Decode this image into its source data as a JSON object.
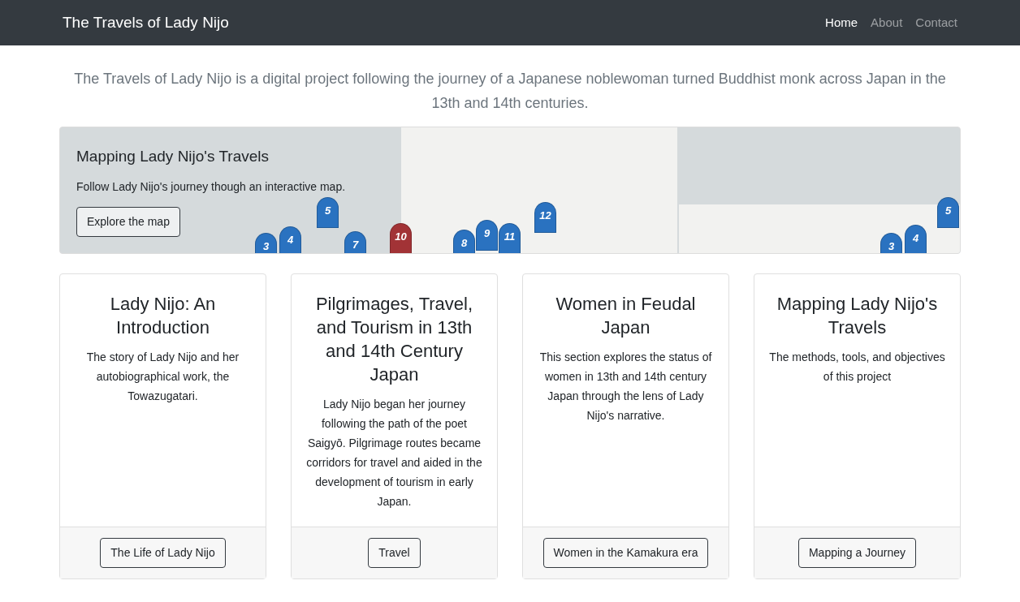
{
  "navbar": {
    "brand": "The Travels of Lady Nijo",
    "links": [
      {
        "label": "Home",
        "selected": true
      },
      {
        "label": "About",
        "selected": false
      },
      {
        "label": "Contact",
        "selected": false
      }
    ]
  },
  "intro": "The Travels of Lady Nijo is a digital project following the journey of a Japanese noblewoman turned Buddhist monk across Japan in the 13th and 14th centuries.",
  "map_banner": {
    "title": "Mapping Lady Nijo's Travels",
    "text": "Follow Lady Nijo's journey though an interactive map.",
    "button": "Explore the map",
    "markers": [
      {
        "label": "3",
        "color": "#2a72c0"
      },
      {
        "label": "4",
        "color": "#2a72c0"
      },
      {
        "label": "5",
        "color": "#2a72c0"
      },
      {
        "label": "7",
        "color": "#2a72c0"
      },
      {
        "label": "10",
        "color": "#a23336"
      },
      {
        "label": "8",
        "color": "#2a72c0"
      },
      {
        "label": "9",
        "color": "#2a72c0"
      },
      {
        "label": "11",
        "color": "#2a72c0"
      },
      {
        "label": "12",
        "color": "#2a72c0"
      },
      {
        "label": "5",
        "color": "#2a72c0"
      },
      {
        "label": "3",
        "color": "#2a72c0"
      },
      {
        "label": "4",
        "color": "#2a72c0"
      }
    ]
  },
  "cards": [
    {
      "title": "Lady Nijo: An Introduction",
      "text": "The story of Lady Nijo and her autobiographical work, the Towazugatari.",
      "button": "The Life of Lady Nijo"
    },
    {
      "title": "Pilgrimages, Travel, and Tourism in 13th and 14th Century Japan",
      "text": "Lady Nijo began her journey following the path of the poet Saigyō. Pilgrimage routes became corridors for travel and aided in the development of tourism in early Japan.",
      "button": "Travel"
    },
    {
      "title": "Women in Feudal Japan",
      "text": "This section explores the status of women in 13th and 14th century Japan through the lens of Lady Nijo's narrative.",
      "button": "Women in the Kamakura era"
    },
    {
      "title": "Mapping Lady Nijo's Travels",
      "text": "The methods, tools, and objectives of this project",
      "button": "Mapping a Journey"
    }
  ]
}
